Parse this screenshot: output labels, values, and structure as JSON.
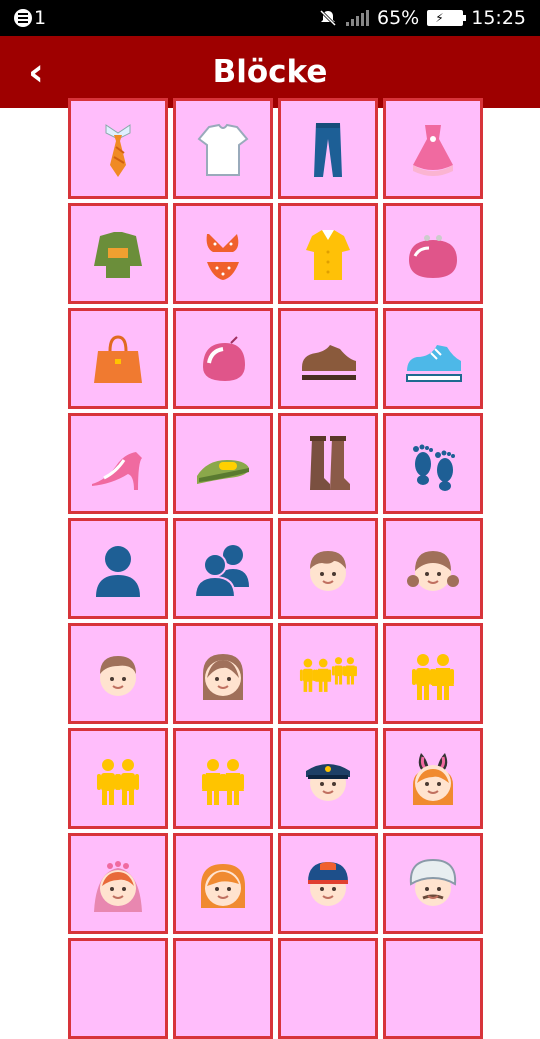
{
  "status_bar": {
    "notification_count": "1",
    "battery_percent": "65%",
    "time": "15:25"
  },
  "header": {
    "back_symbol": "‹",
    "title": "Blöcke"
  },
  "tiles": [
    {
      "icon": "necktie-icon"
    },
    {
      "icon": "tshirt-icon"
    },
    {
      "icon": "jeans-icon"
    },
    {
      "icon": "dress-icon"
    },
    {
      "icon": "kimono-icon"
    },
    {
      "icon": "bikini-icon"
    },
    {
      "icon": "womans-blouse-icon"
    },
    {
      "icon": "purse-icon"
    },
    {
      "icon": "handbag-icon"
    },
    {
      "icon": "pouch-icon"
    },
    {
      "icon": "mans-shoe-icon"
    },
    {
      "icon": "sneaker-icon"
    },
    {
      "icon": "high-heel-icon"
    },
    {
      "icon": "sandal-icon"
    },
    {
      "icon": "boots-icon"
    },
    {
      "icon": "footprints-icon"
    },
    {
      "icon": "bust-silhouette-icon"
    },
    {
      "icon": "busts-silhouette-icon"
    },
    {
      "icon": "boy-icon"
    },
    {
      "icon": "girl-icon"
    },
    {
      "icon": "man-face-icon"
    },
    {
      "icon": "woman-face-icon"
    },
    {
      "icon": "family-icon"
    },
    {
      "icon": "man-woman-holding-hands-icon"
    },
    {
      "icon": "two-men-holding-hands-icon"
    },
    {
      "icon": "two-women-holding-hands-icon"
    },
    {
      "icon": "police-officer-icon"
    },
    {
      "icon": "bunny-ears-icon"
    },
    {
      "icon": "bride-with-veil-icon"
    },
    {
      "icon": "blond-person-icon"
    },
    {
      "icon": "man-with-cap-icon"
    },
    {
      "icon": "man-with-turban-icon"
    },
    {
      "icon": "empty-tile"
    },
    {
      "icon": "empty-tile"
    },
    {
      "icon": "empty-tile"
    },
    {
      "icon": "empty-tile"
    }
  ],
  "colors": {
    "appbar": "#9e0000",
    "tile_bg": "#ffbdfb",
    "tile_border": "#d7343a"
  }
}
